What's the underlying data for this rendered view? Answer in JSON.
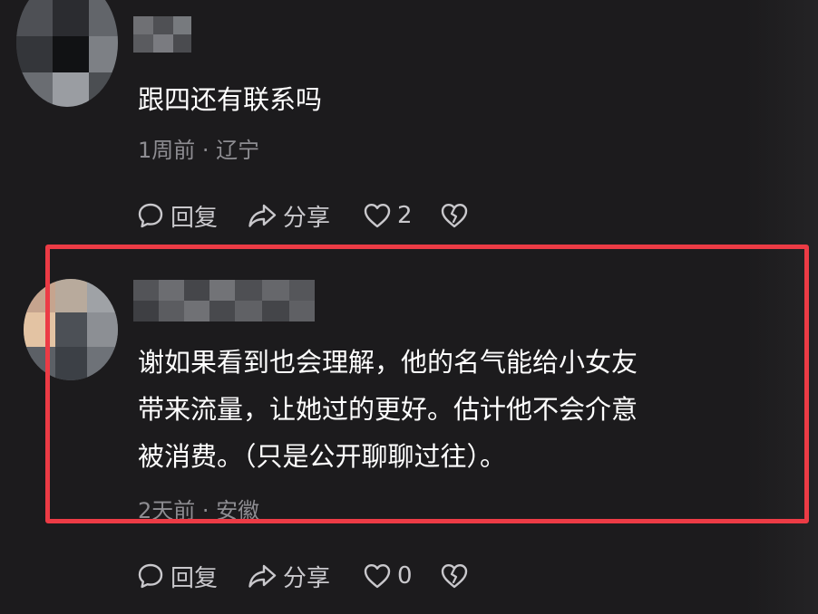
{
  "comments": [
    {
      "text": "跟四还有联系吗",
      "meta": "1周前 · 辽宁",
      "actions": {
        "reply_label": "回复",
        "share_label": "分享",
        "like_count": "2"
      }
    },
    {
      "text": "谢如果看到也会理解，他的名气能给小女友\n带来流量，让她过的更好。估计他不会介意\n被消费。（只是公开聊聊过往）。",
      "meta": "2天前 · 安徽",
      "actions": {
        "reply_label": "回复",
        "share_label": "分享",
        "like_count": "0"
      }
    }
  ],
  "icons": {
    "reply": "speech-bubble-icon",
    "share": "share-arrow-icon",
    "like": "heart-outline-icon",
    "dislike": "broken-heart-icon"
  },
  "colors": {
    "background": "#1c1b1d",
    "text": "#ffffff",
    "meta_text": "#8e8d92",
    "action_text": "#c9c8cc",
    "highlight_border": "#ec3b45"
  }
}
